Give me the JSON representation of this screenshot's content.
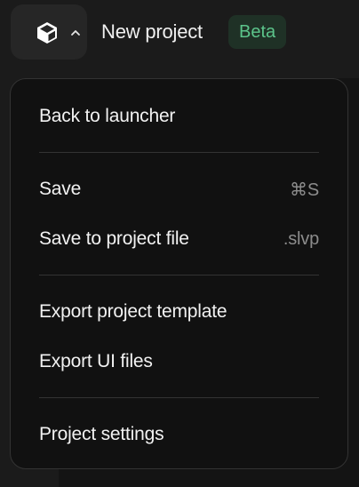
{
  "header": {
    "project_name": "New project",
    "badge": "Beta",
    "logo_icon": "cube-logo-icon",
    "caret_icon": "chevron-up-icon"
  },
  "menu": {
    "items": [
      {
        "label": "Back to launcher",
        "shortcut": ""
      },
      {
        "label": "Save",
        "shortcut": "⌘S"
      },
      {
        "label": "Save to project file",
        "shortcut": ".slvp"
      },
      {
        "label": "Export project template",
        "shortcut": ""
      },
      {
        "label": "Export UI files",
        "shortcut": ""
      },
      {
        "label": "Project settings",
        "shortcut": ""
      }
    ]
  },
  "colors": {
    "background": "#1b1b1b",
    "menu_background": "#111111",
    "badge_text": "#5cc48b",
    "badge_background": "#1f3126"
  }
}
